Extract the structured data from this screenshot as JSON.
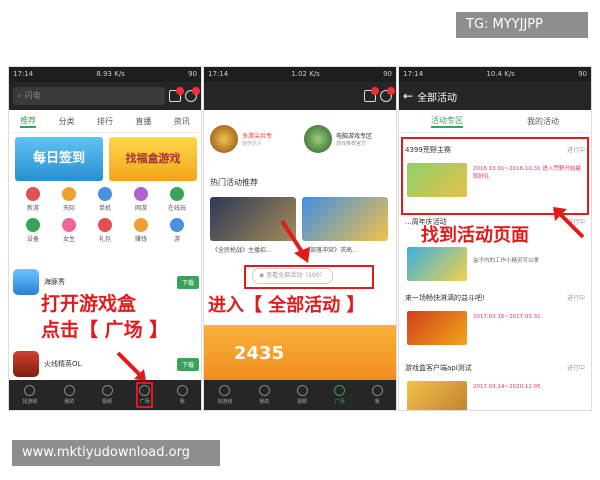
{
  "watermarks": {
    "top": "TG: MYYJJPP",
    "bottom": "www.mktiyudownload.org"
  },
  "status_bar": {
    "p1": {
      "time": "17:14",
      "speed": "8.93 K/s",
      "battery": "90"
    },
    "p2": {
      "time": "17:14",
      "speed": "1.02 K/s",
      "battery": "90"
    },
    "p3": {
      "time": "17:14",
      "speed": "10.4 K/s",
      "battery": "90"
    }
  },
  "panel1": {
    "search_placeholder": "闪电",
    "tabs": [
      "推荐",
      "分类",
      "排行",
      "直播",
      "资讯"
    ],
    "banners": [
      {
        "text": "每日签到"
      },
      {
        "text": "找福盒游戏"
      }
    ],
    "grid": [
      "新游",
      "天际",
      "单机",
      "网游",
      "在线玩",
      "设备",
      "女生",
      "礼包",
      "赚钱",
      "游"
    ],
    "apps": [
      {
        "name": "海豚秀",
        "btn": "下载"
      },
      {
        "name": "火线精英OL",
        "btn": "下载"
      }
    ],
    "bottom_nav": [
      "找游戏",
      "我的",
      "视频",
      "广场",
      "我"
    ],
    "callout_line1": "打开游戏盒",
    "callout_line2": "点击【 广场 】"
  },
  "panel2": {
    "people": [
      {
        "name": "多游尖兵专",
        "sub": "创作达人"
      },
      {
        "name": "电脑游戏专区",
        "sub": "游戏推荐官方"
      }
    ],
    "section": "热门活动推荐",
    "games": [
      {
        "caption": "《全民枪战》主播招..."
      },
      {
        "caption": "《部落冲突》求高..."
      }
    ],
    "pill": "查看全部活动（100）",
    "big_number": "2435",
    "bottom_nav": [
      "找游戏",
      "我的",
      "视频",
      "广场",
      "我"
    ],
    "callout": "进入【 全部活动 】"
  },
  "panel3": {
    "header": "全部活动",
    "tabs": [
      "活动专区",
      "我的活动"
    ],
    "activities": [
      {
        "title": "4399荒野主赛",
        "status": "进行中",
        "meta": "2016.10.01~2016.10.31 进入荒野开始赢取好礼"
      },
      {
        "title": "...周年庆活动",
        "status": "进行中",
        "meta": "盒子内的工作小精灵可以拿"
      },
      {
        "title": "来一场畅快淋漓的益斗吧!",
        "status": "进行中",
        "meta": "2017.03.16~2017.03.31"
      },
      {
        "title": "游戏盒客户端api测试",
        "status": "进行中",
        "meta": "2017.03.14~2020.12.05"
      }
    ],
    "callout": "找到活动页面"
  },
  "colors": {
    "accent": "#3aa35a",
    "callout": "#e21a1a",
    "dark": "#262626"
  }
}
